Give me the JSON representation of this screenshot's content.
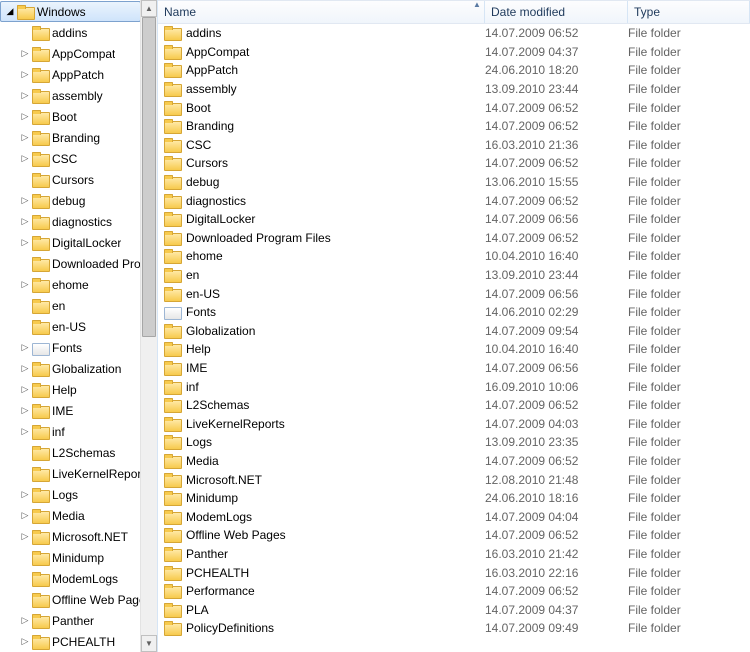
{
  "tree": {
    "root": {
      "label": "Windows",
      "expanded": true
    },
    "items": [
      {
        "label": "addins",
        "exp": "none"
      },
      {
        "label": "AppCompat",
        "exp": "closed"
      },
      {
        "label": "AppPatch",
        "exp": "closed"
      },
      {
        "label": "assembly",
        "exp": "closed"
      },
      {
        "label": "Boot",
        "exp": "closed"
      },
      {
        "label": "Branding",
        "exp": "closed"
      },
      {
        "label": "CSC",
        "exp": "closed"
      },
      {
        "label": "Cursors",
        "exp": "none"
      },
      {
        "label": "debug",
        "exp": "closed"
      },
      {
        "label": "diagnostics",
        "exp": "closed"
      },
      {
        "label": "DigitalLocker",
        "exp": "closed"
      },
      {
        "label": "Downloaded Program Files",
        "exp": "none"
      },
      {
        "label": "ehome",
        "exp": "closed"
      },
      {
        "label": "en",
        "exp": "none"
      },
      {
        "label": "en-US",
        "exp": "none"
      },
      {
        "label": "Fonts",
        "exp": "closed",
        "icon": "fonts"
      },
      {
        "label": "Globalization",
        "exp": "closed"
      },
      {
        "label": "Help",
        "exp": "closed"
      },
      {
        "label": "IME",
        "exp": "closed"
      },
      {
        "label": "inf",
        "exp": "closed"
      },
      {
        "label": "L2Schemas",
        "exp": "none"
      },
      {
        "label": "LiveKernelReports",
        "exp": "none"
      },
      {
        "label": "Logs",
        "exp": "closed"
      },
      {
        "label": "Media",
        "exp": "closed"
      },
      {
        "label": "Microsoft.NET",
        "exp": "closed"
      },
      {
        "label": "Minidump",
        "exp": "none"
      },
      {
        "label": "ModemLogs",
        "exp": "none"
      },
      {
        "label": "Offline Web Pages",
        "exp": "none"
      },
      {
        "label": "Panther",
        "exp": "closed"
      },
      {
        "label": "PCHEALTH",
        "exp": "closed"
      }
    ]
  },
  "columns": {
    "name": "Name",
    "date": "Date modified",
    "type": "Type"
  },
  "type_label": "File folder",
  "rows": [
    {
      "name": "addins",
      "date": "14.07.2009 06:52"
    },
    {
      "name": "AppCompat",
      "date": "14.07.2009 04:37"
    },
    {
      "name": "AppPatch",
      "date": "24.06.2010 18:20"
    },
    {
      "name": "assembly",
      "date": "13.09.2010 23:44"
    },
    {
      "name": "Boot",
      "date": "14.07.2009 06:52"
    },
    {
      "name": "Branding",
      "date": "14.07.2009 06:52"
    },
    {
      "name": "CSC",
      "date": "16.03.2010 21:36"
    },
    {
      "name": "Cursors",
      "date": "14.07.2009 06:52"
    },
    {
      "name": "debug",
      "date": "13.06.2010 15:55"
    },
    {
      "name": "diagnostics",
      "date": "14.07.2009 06:52"
    },
    {
      "name": "DigitalLocker",
      "date": "14.07.2009 06:56"
    },
    {
      "name": "Downloaded Program Files",
      "date": "14.07.2009 06:52"
    },
    {
      "name": "ehome",
      "date": "10.04.2010 16:40"
    },
    {
      "name": "en",
      "date": "13.09.2010 23:44"
    },
    {
      "name": "en-US",
      "date": "14.07.2009 06:56"
    },
    {
      "name": "Fonts",
      "date": "14.06.2010 02:29",
      "icon": "fonts"
    },
    {
      "name": "Globalization",
      "date": "14.07.2009 09:54"
    },
    {
      "name": "Help",
      "date": "10.04.2010 16:40"
    },
    {
      "name": "IME",
      "date": "14.07.2009 06:56"
    },
    {
      "name": "inf",
      "date": "16.09.2010 10:06"
    },
    {
      "name": "L2Schemas",
      "date": "14.07.2009 06:52"
    },
    {
      "name": "LiveKernelReports",
      "date": "14.07.2009 04:03"
    },
    {
      "name": "Logs",
      "date": "13.09.2010 23:35"
    },
    {
      "name": "Media",
      "date": "14.07.2009 06:52"
    },
    {
      "name": "Microsoft.NET",
      "date": "12.08.2010 21:48"
    },
    {
      "name": "Minidump",
      "date": "24.06.2010 18:16"
    },
    {
      "name": "ModemLogs",
      "date": "14.07.2009 04:04"
    },
    {
      "name": "Offline Web Pages",
      "date": "14.07.2009 06:52"
    },
    {
      "name": "Panther",
      "date": "16.03.2010 21:42"
    },
    {
      "name": "PCHEALTH",
      "date": "16.03.2010 22:16"
    },
    {
      "name": "Performance",
      "date": "14.07.2009 06:52"
    },
    {
      "name": "PLA",
      "date": "14.07.2009 04:37"
    },
    {
      "name": "PolicyDefinitions",
      "date": "14.07.2009 09:49"
    }
  ]
}
